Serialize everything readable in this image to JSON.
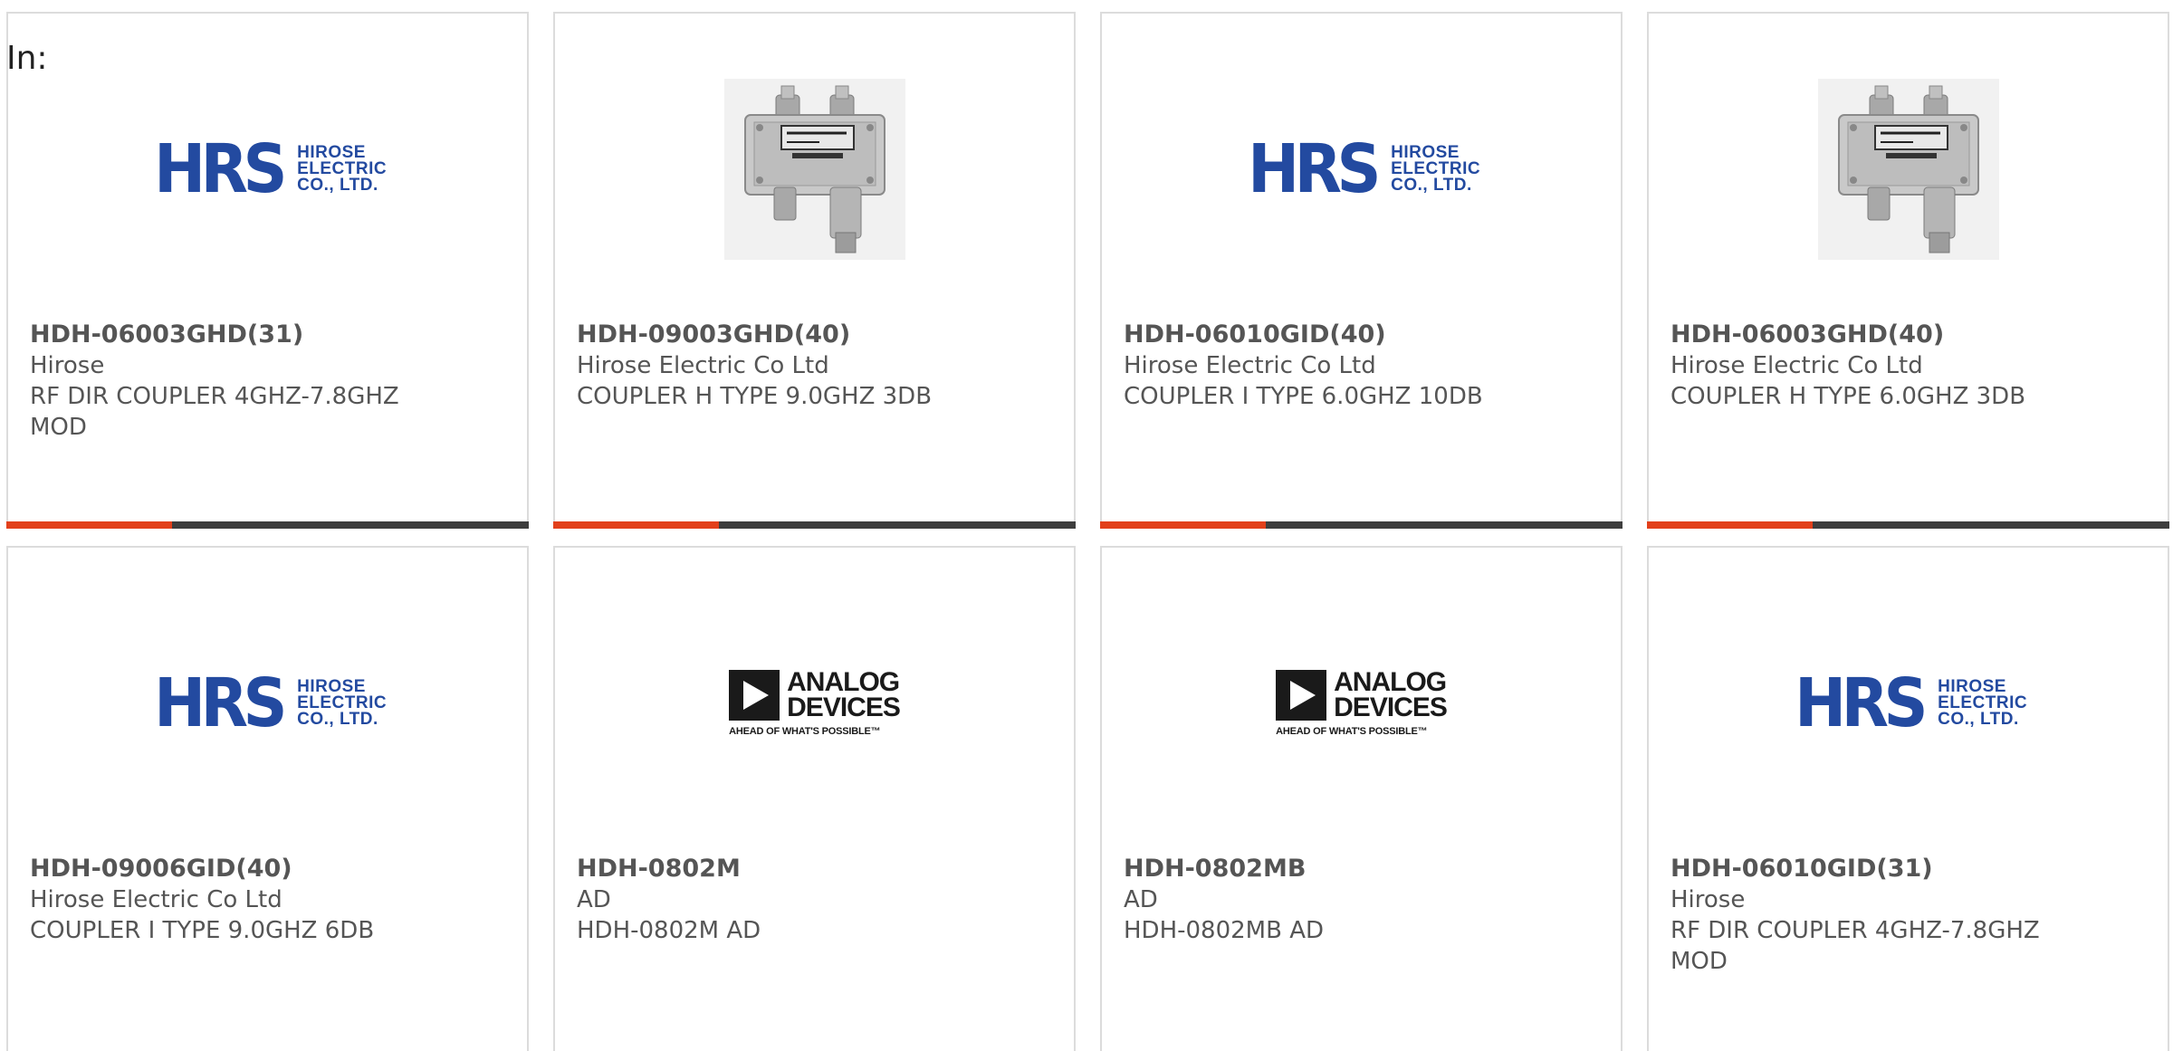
{
  "header": {
    "in_label": "In:"
  },
  "logos": {
    "hrs": {
      "mark": "HRS",
      "lines": [
        "HIROSE",
        "ELECTRIC",
        "CO., LTD."
      ],
      "color": "#234aa0"
    },
    "adi": {
      "lines": [
        "ANALOG",
        "DEVICES"
      ],
      "tagline": "AHEAD OF WHAT'S POSSIBLE™"
    }
  },
  "colors": {
    "accent": "#e2401b",
    "bar": "#3e3e3e",
    "border": "#dcdcdc",
    "text": "#555555"
  },
  "products": [
    {
      "part": "HDH-06003GHD(31)",
      "maker": "Hirose",
      "desc": "RF DIR COUPLER 4GHZ-7.8GHZ MOD",
      "image": "hrs-logo"
    },
    {
      "part": "HDH-09003GHD(40)",
      "maker": "Hirose Electric Co Ltd",
      "desc": "COUPLER H TYPE 9.0GHZ 3DB",
      "image": "coupler-photo"
    },
    {
      "part": "HDH-06010GID(40)",
      "maker": "Hirose Electric Co Ltd",
      "desc": "COUPLER I TYPE 6.0GHZ 10DB",
      "image": "hrs-logo"
    },
    {
      "part": "HDH-06003GHD(40)",
      "maker": "Hirose Electric Co Ltd",
      "desc": "COUPLER H TYPE 6.0GHZ 3DB",
      "image": "coupler-photo"
    },
    {
      "part": "HDH-09006GID(40)",
      "maker": "Hirose Electric Co Ltd",
      "desc": "COUPLER I TYPE 9.0GHZ 6DB",
      "image": "hrs-logo"
    },
    {
      "part": "HDH-0802M",
      "maker": "AD",
      "desc": "HDH-0802M AD",
      "image": "adi-logo"
    },
    {
      "part": "HDH-0802MB",
      "maker": "AD",
      "desc": "HDH-0802MB AD",
      "image": "adi-logo"
    },
    {
      "part": "HDH-06010GID(31)",
      "maker": "Hirose",
      "desc": "RF DIR COUPLER 4GHZ-7.8GHZ MOD",
      "image": "hrs-logo"
    }
  ]
}
